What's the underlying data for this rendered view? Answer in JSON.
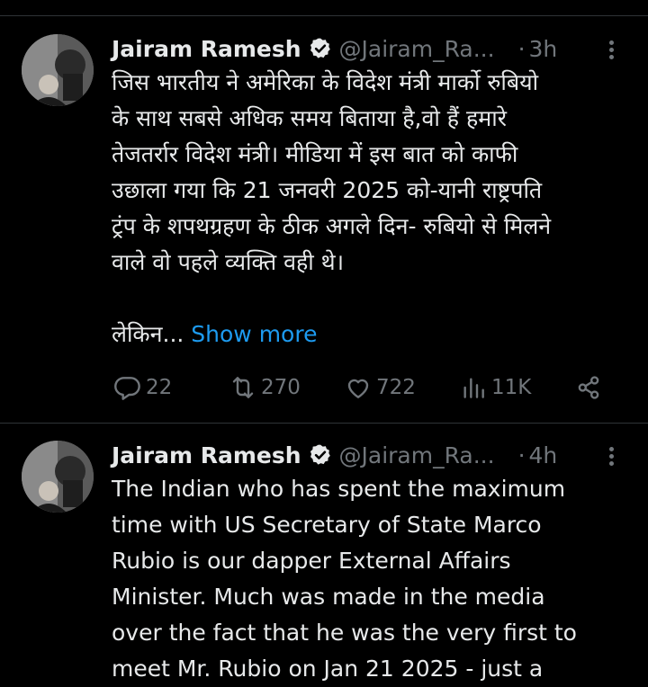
{
  "tweets": [
    {
      "author_name": "Jairam Ramesh",
      "handle": "@Jairam_Ra...",
      "dot": "·",
      "time": "3h",
      "text_lines": [
        "जिस भारतीय ने अमेरिका के विदेश मंत्री मार्को रुबियो",
        "के साथ सबसे अधिक समय बिताया है,वो हैं हमारे",
        "तेजतर्रार विदेश मंत्री। मीडिया में इस बात को काफी",
        "उछाला गया कि 21 जनवरी 2025 को-यानी राष्ट्रपति",
        "ट्रंप के शपथग्रहण के ठीक अगले दिन- रुबियो से मिलने",
        "वाले वो पहले व्यक्ति वही थे।"
      ],
      "tail_text": "लेकिन...",
      "show_more": "Show more",
      "replies": "22",
      "retweets": "270",
      "likes": "722",
      "views": "11K"
    },
    {
      "author_name": "Jairam Ramesh",
      "handle": "@Jairam_Ra...",
      "dot": "·",
      "time": "4h",
      "text_lines": [
        "The Indian who has spent the maximum",
        "time with US Secretary of State Marco",
        "Rubio is our dapper External Affairs",
        "Minister. Much was made in the media",
        "over the fact that he was the very first to",
        "meet Mr. Rubio on Jan 21 2025 - just a"
      ]
    }
  ],
  "icons": {
    "verified": "verified-badge-icon",
    "more": "more-options-icon",
    "reply": "reply-icon",
    "retweet": "retweet-icon",
    "like": "heart-icon",
    "views": "views-icon",
    "share": "share-icon"
  },
  "colors": {
    "background": "#000000",
    "text": "#e7e9ea",
    "muted": "#71767b",
    "link": "#1d9bf0",
    "divider": "#2f3336"
  }
}
